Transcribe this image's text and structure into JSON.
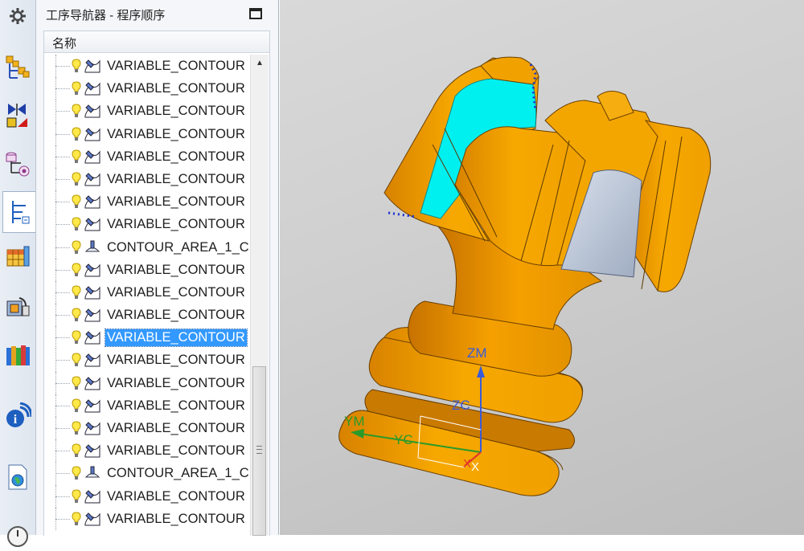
{
  "navigator": {
    "title": "工序导航器 - 程序顺序",
    "column_header": "名称",
    "rows": [
      {
        "label": "VARIABLE_CONTOUR",
        "type": "variable",
        "selected": false
      },
      {
        "label": "VARIABLE_CONTOUR",
        "type": "variable",
        "selected": false
      },
      {
        "label": "VARIABLE_CONTOUR",
        "type": "variable",
        "selected": false
      },
      {
        "label": "VARIABLE_CONTOUR",
        "type": "variable",
        "selected": false
      },
      {
        "label": "VARIABLE_CONTOUR",
        "type": "variable",
        "selected": false
      },
      {
        "label": "VARIABLE_CONTOUR",
        "type": "variable",
        "selected": false
      },
      {
        "label": "VARIABLE_CONTOUR",
        "type": "variable",
        "selected": false
      },
      {
        "label": "VARIABLE_CONTOUR",
        "type": "variable",
        "selected": false
      },
      {
        "label": "CONTOUR_AREA_1_C",
        "type": "area",
        "selected": false
      },
      {
        "label": "VARIABLE_CONTOUR",
        "type": "variable",
        "selected": false
      },
      {
        "label": "VARIABLE_CONTOUR",
        "type": "variable",
        "selected": false
      },
      {
        "label": "VARIABLE_CONTOUR",
        "type": "variable",
        "selected": false
      },
      {
        "label": "VARIABLE_CONTOUR",
        "type": "variable",
        "selected": true
      },
      {
        "label": "VARIABLE_CONTOUR",
        "type": "variable",
        "selected": false
      },
      {
        "label": "VARIABLE_CONTOUR",
        "type": "variable",
        "selected": false
      },
      {
        "label": "VARIABLE_CONTOUR",
        "type": "variable",
        "selected": false
      },
      {
        "label": "VARIABLE_CONTOUR",
        "type": "variable",
        "selected": false
      },
      {
        "label": "VARIABLE_CONTOUR",
        "type": "variable",
        "selected": false
      },
      {
        "label": "CONTOUR_AREA_1_C",
        "type": "area",
        "selected": false
      },
      {
        "label": "VARIABLE_CONTOUR",
        "type": "variable",
        "selected": false
      },
      {
        "label": "VARIABLE_CONTOUR",
        "type": "variable",
        "selected": false
      }
    ]
  },
  "resource_bar": {
    "icons": [
      "gear-icon",
      "assembly-navigator-icon",
      "constraint-navigator-icon",
      "part-navigator-icon",
      "operation-navigator-icon",
      "machine-tool-navigator-icon",
      "reuse-library-icon",
      "history-icon",
      "info-icon",
      "web-browser-icon",
      "clock-icon"
    ]
  },
  "viewport": {
    "axis_labels": {
      "zm": "ZM",
      "zc": "ZC",
      "ym": "YM",
      "yc": "YC"
    }
  },
  "colors": {
    "model_orange": "#f5a300",
    "cut_cyan": "#00f0f0",
    "selection_blue": "#3399ff",
    "axis_blue": "#3a5bd9",
    "axis_green": "#2a9a2a",
    "axis_red": "#e03030"
  }
}
